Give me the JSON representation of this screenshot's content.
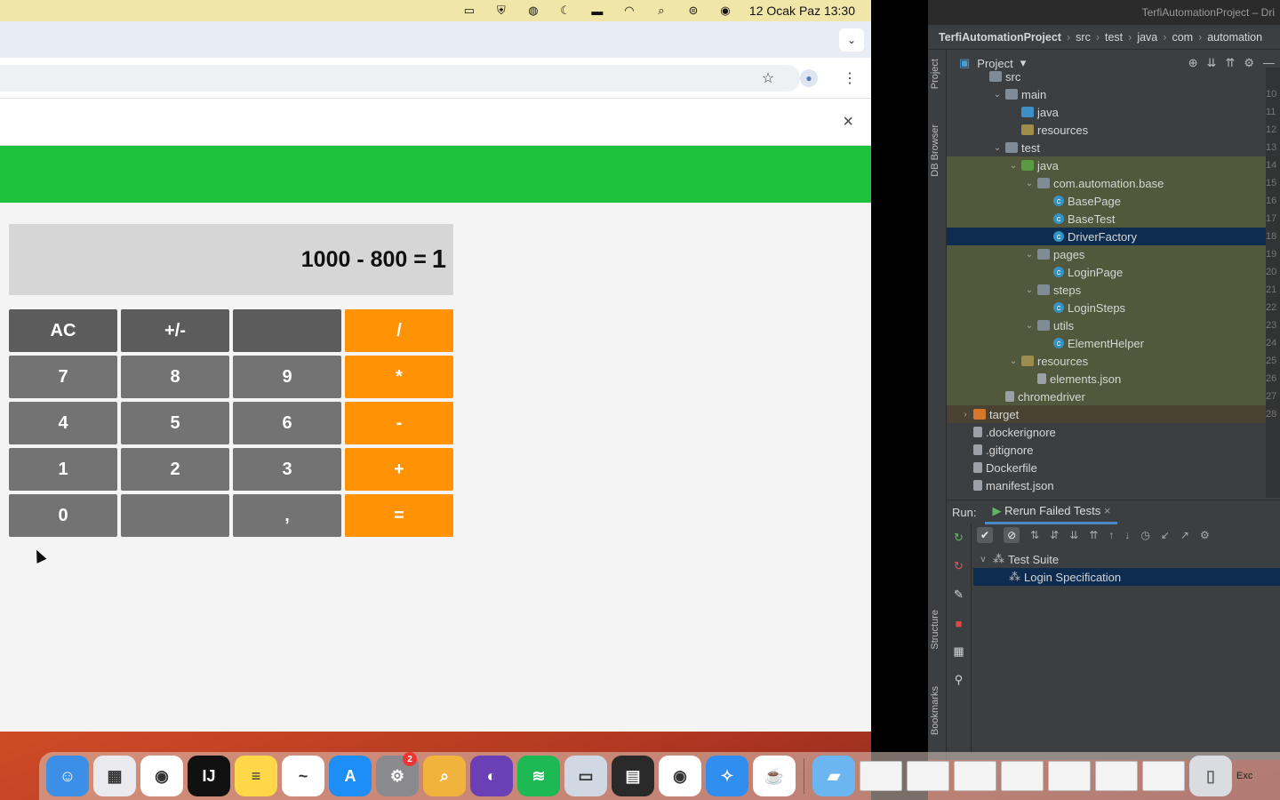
{
  "menubar": {
    "clock": "12 Ocak Paz  13:30",
    "icons": [
      "window-icon",
      "shield-icon",
      "globe-icon",
      "moon-icon",
      "battery-icon",
      "wifi-icon",
      "search-icon",
      "control-center-icon",
      "siri-icon"
    ]
  },
  "browser": {
    "infobar_close": "×",
    "calculator": {
      "display_expr": "1000 - 800 =",
      "display_result": "1",
      "keys": [
        {
          "label": "AC",
          "kind": "dark"
        },
        {
          "label": "+/-",
          "kind": "dark"
        },
        {
          "label": "",
          "kind": "dark"
        },
        {
          "label": "/",
          "kind": "op"
        },
        {
          "label": "7",
          "kind": "num"
        },
        {
          "label": "8",
          "kind": "num"
        },
        {
          "label": "9",
          "kind": "num"
        },
        {
          "label": "*",
          "kind": "op"
        },
        {
          "label": "4",
          "kind": "num"
        },
        {
          "label": "5",
          "kind": "num"
        },
        {
          "label": "6",
          "kind": "num"
        },
        {
          "label": "-",
          "kind": "op"
        },
        {
          "label": "1",
          "kind": "num"
        },
        {
          "label": "2",
          "kind": "num"
        },
        {
          "label": "3",
          "kind": "num"
        },
        {
          "label": "+",
          "kind": "op"
        },
        {
          "label": "0",
          "kind": "num"
        },
        {
          "label": "",
          "kind": "num"
        },
        {
          "label": ",",
          "kind": "num"
        },
        {
          "label": "=",
          "kind": "op"
        }
      ]
    }
  },
  "ide": {
    "title": "TerfiAutomationProject – Dri",
    "breadcrumb": [
      "TerfiAutomationProject",
      "src",
      "test",
      "java",
      "com",
      "automation"
    ],
    "panel_label": "Project",
    "side_tabs": {
      "project": "Project",
      "db": "DB Browser",
      "structure": "Structure",
      "bookmarks": "Bookmarks"
    },
    "tree": [
      {
        "indent": 2,
        "chev": "",
        "icon": "folder",
        "label": "src",
        "style": ""
      },
      {
        "indent": 3,
        "chev": "v",
        "icon": "folder",
        "label": "main",
        "style": ""
      },
      {
        "indent": 4,
        "chev": "",
        "icon": "src",
        "label": "java",
        "style": ""
      },
      {
        "indent": 4,
        "chev": "",
        "icon": "res",
        "label": "resources",
        "style": ""
      },
      {
        "indent": 3,
        "chev": "v",
        "icon": "folder",
        "label": "test",
        "style": ""
      },
      {
        "indent": 4,
        "chev": "v",
        "icon": "test",
        "label": "java",
        "style": "hl"
      },
      {
        "indent": 5,
        "chev": "v",
        "icon": "folder",
        "label": "com.automation.base",
        "style": "hl"
      },
      {
        "indent": 6,
        "chev": "",
        "icon": "cls",
        "label": "BasePage",
        "style": "hl"
      },
      {
        "indent": 6,
        "chev": "",
        "icon": "cls",
        "label": "BaseTest",
        "style": "hl"
      },
      {
        "indent": 6,
        "chev": "",
        "icon": "cls",
        "label": "DriverFactory",
        "style": "sel"
      },
      {
        "indent": 5,
        "chev": "v",
        "icon": "folder",
        "label": "pages",
        "style": "hl"
      },
      {
        "indent": 6,
        "chev": "",
        "icon": "cls",
        "label": "LoginPage",
        "style": "hl"
      },
      {
        "indent": 5,
        "chev": "v",
        "icon": "folder",
        "label": "steps",
        "style": "hl"
      },
      {
        "indent": 6,
        "chev": "",
        "icon": "cls",
        "label": "LoginSteps",
        "style": "hl"
      },
      {
        "indent": 5,
        "chev": "v",
        "icon": "folder",
        "label": "utils",
        "style": "hl"
      },
      {
        "indent": 6,
        "chev": "",
        "icon": "cls",
        "label": "ElementHelper",
        "style": "hl"
      },
      {
        "indent": 4,
        "chev": "v",
        "icon": "res",
        "label": "resources",
        "style": "hl"
      },
      {
        "indent": 5,
        "chev": "",
        "icon": "file",
        "label": "elements.json",
        "style": "hl"
      },
      {
        "indent": 3,
        "chev": "",
        "icon": "file",
        "label": "chromedriver",
        "style": "hl"
      },
      {
        "indent": 1,
        "chev": ">",
        "icon": "target",
        "label": "target",
        "style": "tg"
      },
      {
        "indent": 1,
        "chev": "",
        "icon": "file",
        "label": ".dockerignore",
        "style": ""
      },
      {
        "indent": 1,
        "chev": "",
        "icon": "file",
        "label": ".gitignore",
        "style": ""
      },
      {
        "indent": 1,
        "chev": "",
        "icon": "file",
        "label": "Dockerfile",
        "style": ""
      },
      {
        "indent": 1,
        "chev": "",
        "icon": "file",
        "label": "manifest.json",
        "style": ""
      }
    ],
    "gutter": [
      "",
      "10",
      "11",
      "12",
      "13",
      "14",
      "15",
      "16",
      "17",
      "18",
      "19",
      "20",
      "21",
      "22",
      "23",
      "24",
      "25",
      "26",
      "27",
      "28"
    ],
    "run": {
      "label": "Run:",
      "tab": "Rerun Failed Tests",
      "tab_close": "×",
      "suite": "Test Suite",
      "spec": "Login Specification"
    }
  },
  "dock": {
    "apps": [
      {
        "name": "finder",
        "color": "#3b8fe6",
        "glyph": "☺"
      },
      {
        "name": "launchpad",
        "color": "#e9e9ee",
        "glyph": "▦"
      },
      {
        "name": "chrome",
        "color": "#ffffff",
        "glyph": "◉"
      },
      {
        "name": "intellij",
        "color": "#111111",
        "glyph": "IJ"
      },
      {
        "name": "notes",
        "color": "#ffd84a",
        "glyph": "≡"
      },
      {
        "name": "freeform",
        "color": "#ffffff",
        "glyph": "~"
      },
      {
        "name": "app-store",
        "color": "#1c8ef5",
        "glyph": "A"
      },
      {
        "name": "system-settings",
        "color": "#8a8a8e",
        "glyph": "⚙"
      },
      {
        "name": "magnifier",
        "color": "#f1b33c",
        "glyph": "⌕"
      },
      {
        "name": "arc",
        "color": "#6b3fb5",
        "glyph": "◐"
      },
      {
        "name": "spotify",
        "color": "#1db954",
        "glyph": "≋"
      },
      {
        "name": "preview",
        "color": "#cfd8e3",
        "glyph": "▭"
      },
      {
        "name": "calculator",
        "color": "#2a2a2a",
        "glyph": "▤"
      },
      {
        "name": "chrome-2",
        "color": "#ffffff",
        "glyph": "◉"
      },
      {
        "name": "safari",
        "color": "#2f8ef0",
        "glyph": "✧"
      },
      {
        "name": "java",
        "color": "#ffffff",
        "glyph": "☕"
      }
    ],
    "badge": "2",
    "right_label": "Exc"
  }
}
